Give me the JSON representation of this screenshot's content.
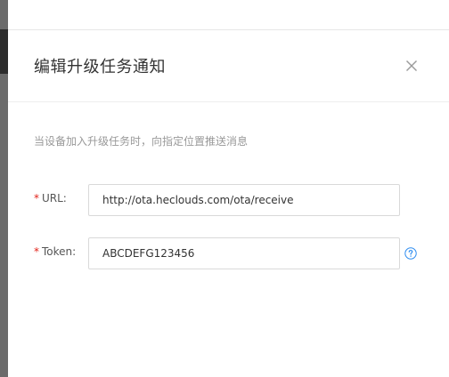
{
  "dialog": {
    "title": "编辑升级任务通知",
    "description": "当设备加入升级任务时，向指定位置推送消息"
  },
  "form": {
    "url": {
      "required_mark": "*",
      "label": "URL:",
      "value": "http://ota.heclouds.com/ota/receive"
    },
    "token": {
      "required_mark": "*",
      "label": "Token:",
      "value": "ABCDEFG123456"
    }
  },
  "icons": {
    "close": "close-icon",
    "help": "question-circle-icon"
  },
  "colors": {
    "required": "#e2231a",
    "help_icon": "#2d8cf0",
    "title": "#333333",
    "description": "#999999"
  }
}
